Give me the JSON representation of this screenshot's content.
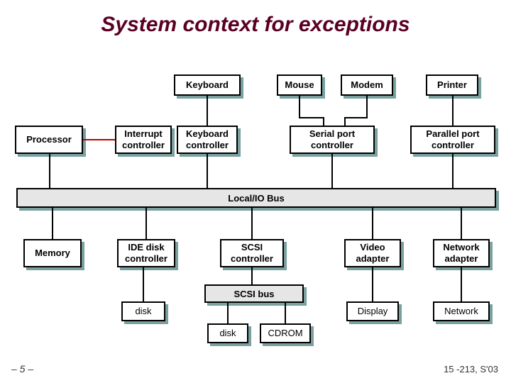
{
  "title": "System context for exceptions",
  "row1": {
    "keyboard": "Keyboard",
    "mouse": "Mouse",
    "modem": "Modem",
    "printer": "Printer"
  },
  "row2": {
    "processor": "Processor",
    "interrupt_ctrl": "Interrupt\ncontroller",
    "keyboard_ctrl": "Keyboard\ncontroller",
    "serial_ctrl": "Serial port\ncontroller",
    "parallel_ctrl": "Parallel port\ncontroller"
  },
  "bus": "Local/IO Bus",
  "row3": {
    "memory": "Memory",
    "ide_ctrl": "IDE disk\ncontroller",
    "scsi_ctrl": "SCSI\ncontroller",
    "video_adapter": "Video\nadapter",
    "network_adapter": "Network\nadapter"
  },
  "scsi_bus": "SCSI bus",
  "row4": {
    "disk1": "disk",
    "disk2": "disk",
    "cdrom": "CDROM",
    "display": "Display",
    "network": "Network"
  },
  "pagenum": "– 5 –",
  "course": "15 -213, S'03"
}
